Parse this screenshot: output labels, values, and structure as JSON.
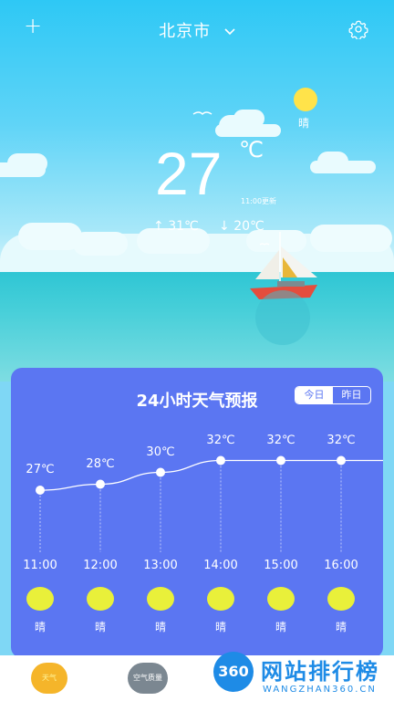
{
  "header": {
    "city": "北京市",
    "add_label": "+",
    "dropdown_icon": "chevron-down-icon",
    "settings_icon": "gear-icon"
  },
  "current": {
    "temperature": "27",
    "unit": "℃",
    "updated": "11:00更新",
    "high": "31℃",
    "low": "20℃",
    "condition": "晴"
  },
  "forecast": {
    "title": "24小时天气预报",
    "toggle_today": "今日",
    "toggle_yesterday": "昨日",
    "hours": [
      {
        "time": "11:00",
        "temp": "27℃",
        "temp_value": 27,
        "cond": "晴"
      },
      {
        "time": "12:00",
        "temp": "28℃",
        "temp_value": 28,
        "cond": "晴"
      },
      {
        "time": "13:00",
        "temp": "30℃",
        "temp_value": 30,
        "cond": "晴"
      },
      {
        "time": "14:00",
        "temp": "32℃",
        "temp_value": 32,
        "cond": "晴"
      },
      {
        "time": "15:00",
        "temp": "32℃",
        "temp_value": 32,
        "cond": "晴"
      },
      {
        "time": "16:00",
        "temp": "32℃",
        "temp_value": 32,
        "cond": "晴"
      }
    ]
  },
  "bottom_tabs": [
    {
      "label": "天气",
      "color": "#f5b52a"
    },
    {
      "label": "空气质量",
      "color": "#7b8791"
    }
  ],
  "watermark": {
    "badge": "360",
    "title": "网站排行榜",
    "url": "WANGZHAN360.CN"
  },
  "colors": {
    "card": "#5b76f2",
    "sun": "#e9f03a",
    "sky": "#2ec8f5",
    "sea": "#2fc6d4"
  }
}
